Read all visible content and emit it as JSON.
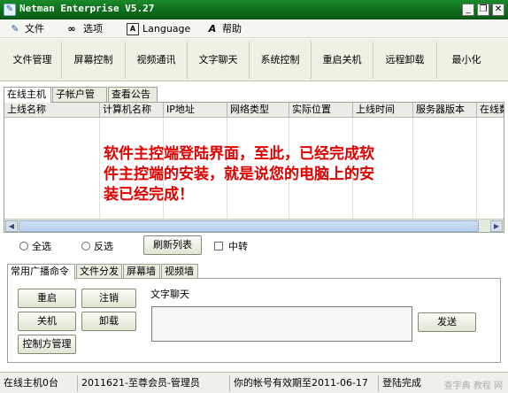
{
  "window": {
    "title": "Netman Enterprise V5.27",
    "controls": {
      "minimize": "_",
      "restore": "❐",
      "close": "✕"
    }
  },
  "menu": {
    "items": [
      {
        "label": "文件",
        "icon": "doc-edit-icon"
      },
      {
        "label": "选项",
        "icon": "glasses-icon"
      },
      {
        "label": "Language",
        "icon": "language-icon"
      },
      {
        "label": "帮助",
        "icon": "help-icon"
      }
    ]
  },
  "toolbar": {
    "items": [
      "文件管理",
      "屏幕控制",
      "视频通讯",
      "文字聊天",
      "系统控制",
      "重启关机",
      "远程卸载",
      "最小化"
    ]
  },
  "top_tabs": [
    "在线主机",
    "子帐户管理",
    "查看公告"
  ],
  "host_list": {
    "columns": [
      "上线名称",
      "计算机名称",
      "IP地址",
      "网络类型",
      "实际位置",
      "上线时间",
      "服务器版本",
      "在线数"
    ],
    "rows": []
  },
  "overlay_note": "软件主控端登陆界面，至此，已经完成软件主控端的安装，就是说您的电脑上的安装已经完成！",
  "controls": {
    "select_all": "全选",
    "invert_select": "反选",
    "refresh_button": "刷新列表",
    "relay_checkbox": "中转"
  },
  "bottom_tabs": [
    "常用广播命令",
    "文件分发",
    "屏幕墙",
    "视频墙"
  ],
  "broadcast": {
    "restart": "重启",
    "logoff": "注销",
    "shutdown": "关机",
    "uninstall": "卸载",
    "controller_manage": "控制方管理",
    "chat_label": "文字聊天",
    "chat_value": "",
    "send": "发送"
  },
  "status": {
    "online_count": "在线主机0台",
    "account": "2011621-至尊会员-管理员",
    "expiry": "你的帐号有效期至2011-06-17",
    "login_state": "登陆完成",
    "watermark": "查字典 教程 网"
  },
  "colors": {
    "titlebar": "#0d6b1a",
    "note_text": "#e10000",
    "scroll_thumb": "#b7cdec"
  }
}
